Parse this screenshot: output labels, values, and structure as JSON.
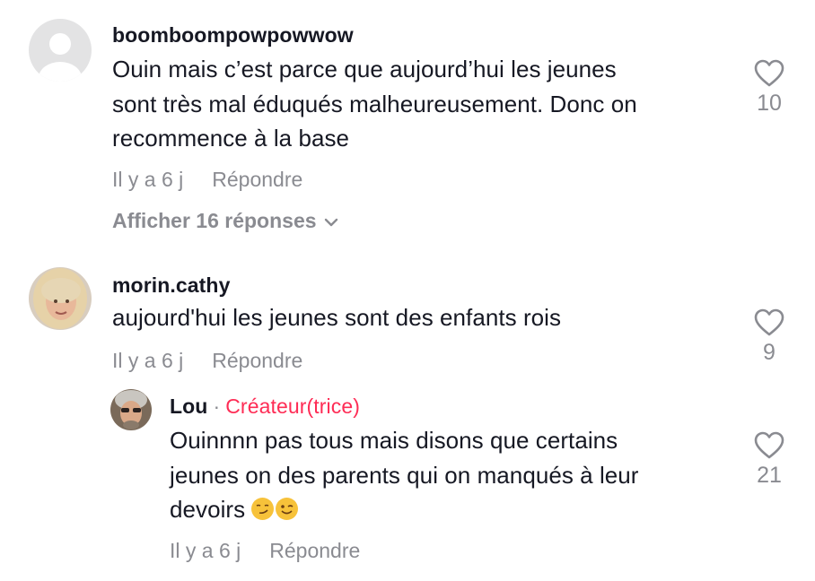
{
  "comments": [
    {
      "username": "boomboompowpowwow",
      "text_lines": [
        "Ouin mais c’est parce que aujourd’hui les jeunes",
        "sont très mal éduqués malheureusement. Donc on",
        "recommence à la base"
      ],
      "time": "Il y a 6 j",
      "reply_label": "Répondre",
      "likes": "10",
      "view_replies": "Afficher 16 réponses",
      "avatar": "default-avatar-icon"
    },
    {
      "username": "morin.cathy",
      "text_lines": [
        "aujourd'hui les jeunes sont des enfants rois"
      ],
      "time": "Il y a 6 j",
      "reply_label": "Répondre",
      "likes": "9",
      "avatar": "user-photo"
    }
  ],
  "reply": {
    "username": "Lou",
    "separator": "·",
    "badge": "Créateur(trice)",
    "text_lines": [
      "Ouinnnn pas tous mais disons que certains",
      "jeunes on des parents qui on manqués à leur",
      "devoirs"
    ],
    "emojis": [
      "smirking-face-emoji",
      "winking-face-emoji"
    ],
    "time": "Il y a 6 j",
    "reply_label": "Répondre",
    "likes": "21",
    "avatar": "user-photo"
  },
  "colors": {
    "text": "#161823",
    "secondary": "#8a8b91",
    "creator": "#fe2c55"
  }
}
